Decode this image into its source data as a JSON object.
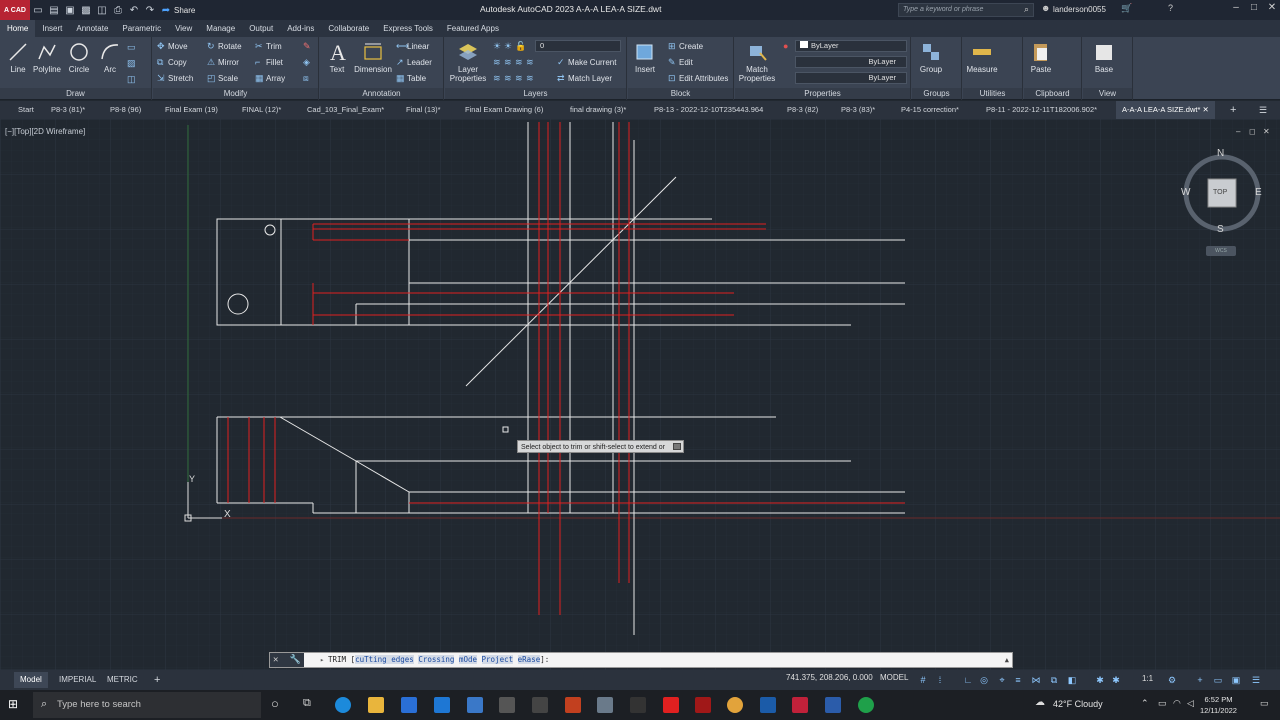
{
  "titlebar": {
    "app_badge": "A CAD",
    "share_label": "Share",
    "title": "Autodesk AutoCAD 2023   A-A-A LEA-A SIZE.dwt",
    "search_placeholder": "Type a keyword or phrase",
    "user": "landerson0055"
  },
  "ribbon_tabs": [
    "Home",
    "Insert",
    "Annotate",
    "Parametric",
    "View",
    "Manage",
    "Output",
    "Add-ins",
    "Collaborate",
    "Express Tools",
    "Featured Apps"
  ],
  "ribbon": {
    "draw": {
      "title": "Draw",
      "line": "Line",
      "polyline": "Polyline",
      "circle": "Circle",
      "arc": "Arc"
    },
    "modify": {
      "title": "Modify",
      "move": "Move",
      "rotate": "Rotate",
      "trim": "Trim",
      "copy": "Copy",
      "mirror": "Mirror",
      "fillet": "Fillet",
      "stretch": "Stretch",
      "scale": "Scale",
      "array": "Array"
    },
    "annotation": {
      "title": "Annotation",
      "text": "Text",
      "dimension": "Dimension",
      "linear": "Linear",
      "leader": "Leader",
      "table": "Table"
    },
    "layers": {
      "title": "Layers",
      "layer_properties_1": "Layer",
      "layer_properties_2": "Properties",
      "current_layer": "0",
      "make_current": "Make Current",
      "match_layer": "Match Layer"
    },
    "block": {
      "title": "Block",
      "insert": "Insert",
      "create": "Create",
      "edit": "Edit",
      "edit_attributes": "Edit Attributes"
    },
    "properties": {
      "title": "Properties",
      "match_1": "Match",
      "match_2": "Properties",
      "color": "ByLayer",
      "linetype": "ByLayer",
      "lineweight": "ByLayer"
    },
    "groups": {
      "title": "Groups",
      "group": "Group"
    },
    "utilities": {
      "title": "Utilities",
      "measure": "Measure"
    },
    "clipboard": {
      "title": "Clipboard",
      "paste": "Paste"
    },
    "view": {
      "title": "View",
      "base": "Base"
    }
  },
  "file_tabs": [
    "Start",
    "P8-3 (81)*",
    "P8-8 (96)",
    "Final Exam (19)",
    "FINAL (12)*",
    "Cad_103_Final_Exam*",
    "Final (13)*",
    "Final Exam Drawing (6)",
    "final drawing (3)*",
    "P8-13 - 2022-12-10T235443.964",
    "P8-3 (82)",
    "P8-3 (83)*",
    "P4-15 correction*",
    "P8-11 - 2022-12-11T182006.902*",
    "A-A-A LEA-A SIZE.dwt*"
  ],
  "viewport": {
    "label": "[−][Top][2D Wireframe]",
    "tooltip": "Select object to trim or shift-select to extend or",
    "viewcube": {
      "n": "N",
      "s": "S",
      "e": "E",
      "w": "W",
      "top": "TOP",
      "wcs": "WCS"
    },
    "ucs_y": "Y",
    "ucs_x": "X"
  },
  "command_line": {
    "command": "TRIM",
    "options": [
      "cuTting edges",
      "Crossing",
      "mOde",
      "Project",
      "eRase"
    ]
  },
  "layout_tabs": [
    "Model",
    "IMPERIAL",
    "METRIC"
  ],
  "status": {
    "coords": "741.375, 208.206, 0.000",
    "model": "MODEL",
    "scale": "1:1"
  },
  "taskbar": {
    "search": "Type here to search",
    "weather": "42°F  Cloudy",
    "time": "6:52 PM",
    "date": "12/11/2022"
  },
  "colors": {
    "accent_red": "#e02020",
    "geometry_white": "#e8e8e8",
    "background": "#212830"
  }
}
